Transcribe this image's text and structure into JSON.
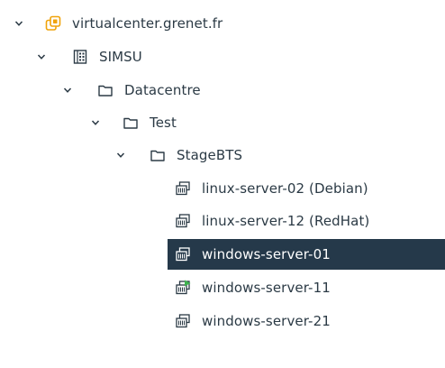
{
  "tree": {
    "vcenter": {
      "label": "virtualcenter.grenet.fr",
      "icon": "vcenter-icon"
    },
    "building": {
      "label": "SIMSU",
      "icon": "building-icon"
    },
    "datacentre": {
      "label": "Datacentre",
      "icon": "folder-icon"
    },
    "test": {
      "label": "Test",
      "icon": "folder-icon"
    },
    "stagebts": {
      "label": "StageBTS",
      "icon": "folder-icon"
    },
    "vms": [
      {
        "label": "linux-server-02 (Debian)",
        "icon": "vm-icon",
        "state": "off"
      },
      {
        "label": "linux-server-12 (RedHat)",
        "icon": "vm-icon",
        "state": "off"
      },
      {
        "label": "windows-server-01",
        "icon": "vm-icon",
        "state": "off",
        "selected": true
      },
      {
        "label": "windows-server-11",
        "icon": "vm-running-icon",
        "state": "running"
      },
      {
        "label": "windows-server-21",
        "icon": "vm-icon",
        "state": "off"
      }
    ]
  },
  "colors": {
    "selection": "#25394a",
    "vcenter_icon": "#f0a30a",
    "running_badge": "#3fb24f",
    "icon_stroke": "#2b3a45"
  }
}
